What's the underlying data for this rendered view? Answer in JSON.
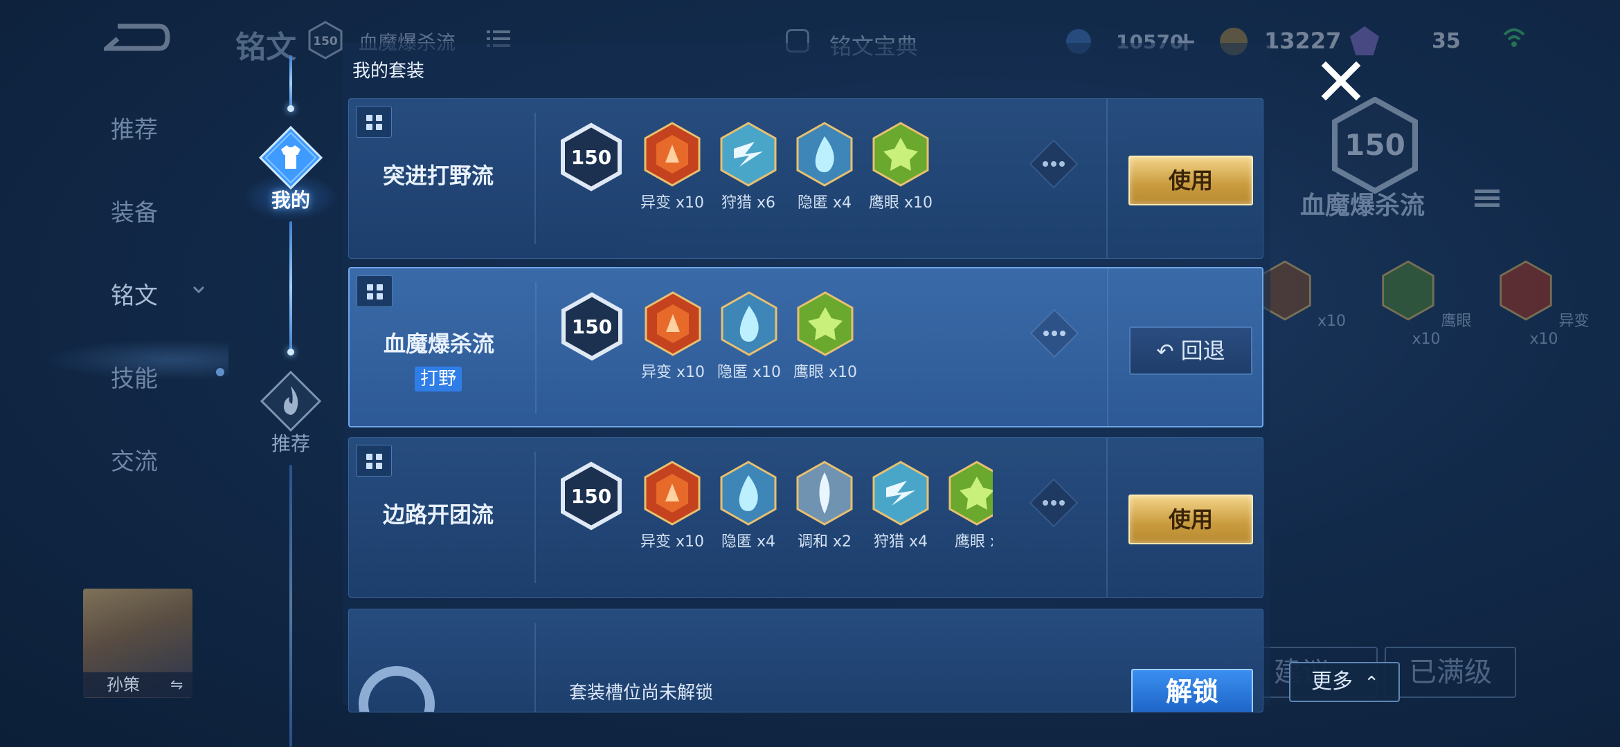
{
  "topbar": {
    "title": "铭文",
    "level": "150",
    "current_set": "血魔爆杀流",
    "codex_label": "铭文宝典",
    "currency1": "10570",
    "currency2": "13227",
    "currency3": "35",
    "plus": "+"
  },
  "leftnav": {
    "items": [
      {
        "label": "推荐"
      },
      {
        "label": "装备"
      },
      {
        "label": "铭文"
      },
      {
        "label": "技能"
      },
      {
        "label": "交流"
      }
    ],
    "hero_name": "孙策",
    "swap_glyph": "⇋"
  },
  "rail": {
    "mine_label": "我的",
    "recommend_label": "推荐"
  },
  "modal": {
    "title": "我的套装",
    "sets": [
      {
        "name": "突进打野流",
        "level": "150",
        "action": "使用",
        "runes": [
          {
            "name": "异变",
            "count": "x10",
            "color": "red"
          },
          {
            "name": "狩猎",
            "count": "x6",
            "color": "blue-lightning"
          },
          {
            "name": "隐匿",
            "count": "x4",
            "color": "blue"
          },
          {
            "name": "鹰眼",
            "count": "x10",
            "color": "green"
          }
        ]
      },
      {
        "name": "血魔爆杀流",
        "tag": "打野",
        "level": "150",
        "action": "回退",
        "runes": [
          {
            "name": "异变",
            "count": "x10",
            "color": "red"
          },
          {
            "name": "隐匿",
            "count": "x10",
            "color": "blue"
          },
          {
            "name": "鹰眼",
            "count": "x10",
            "color": "green"
          }
        ]
      },
      {
        "name": "边路开团流",
        "level": "150",
        "action": "使用",
        "runes": [
          {
            "name": "异变",
            "count": "x10",
            "color": "red"
          },
          {
            "name": "隐匿",
            "count": "x4",
            "color": "blue"
          },
          {
            "name": "调和",
            "count": "x2",
            "color": "silver"
          },
          {
            "name": "狩猎",
            "count": "x4",
            "color": "blue-lightning"
          },
          {
            "name": "鹰眼",
            "count": "x",
            "color": "green"
          }
        ]
      }
    ],
    "locked_text": "套装槽位尚未解锁",
    "unlock_label": "解锁"
  },
  "rightpanel": {
    "level": "150",
    "name": "血魔爆杀流",
    "runes": [
      {
        "label": "x10"
      },
      {
        "label": "鹰眼x10"
      },
      {
        "label": "异变x10"
      }
    ],
    "btn1": "建议",
    "btn2": "已满级",
    "more_label": "更多",
    "more_caret": "⌃"
  },
  "colors": {
    "accent_gold": "#d9b05a",
    "accent_blue": "#2f7ee8",
    "background": "#122a4a"
  }
}
